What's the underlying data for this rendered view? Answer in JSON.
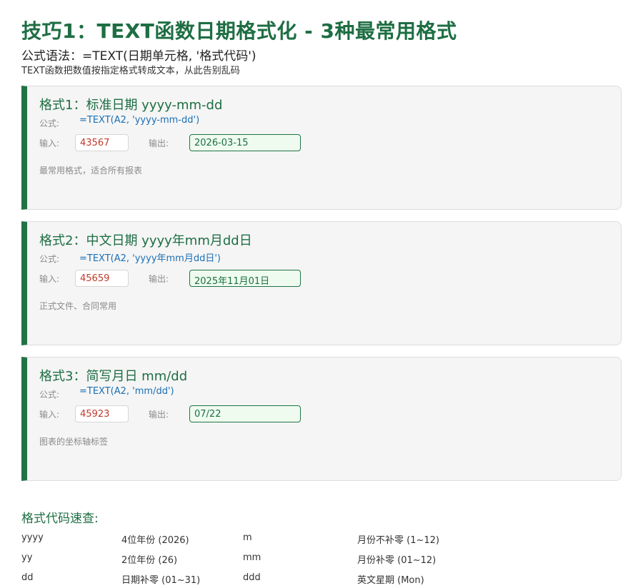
{
  "header": {
    "title": "技巧1：TEXT函数日期格式化 - 3种最常用格式",
    "syntax_label": "公式语法：",
    "syntax_formula": "=TEXT(日期单元格, '格式代码')",
    "subtitle": "TEXT函数把数值按指定格式转成文本，从此告别乱码"
  },
  "labels": {
    "formula": "公式:",
    "input": "输入:",
    "output": "输出:"
  },
  "cards": [
    {
      "title": "格式1：标准日期 yyyy-mm-dd",
      "formula": "=TEXT(A2, 'yyyy-mm-dd')",
      "input": "43567",
      "output": "2026-03-15",
      "note": "最常用格式，适合所有报表"
    },
    {
      "title": "格式2：中文日期 yyyy年mm月dd日",
      "formula": "=TEXT(A2, 'yyyy年mm月dd日')",
      "input": "45659",
      "output": "2025年11月01日",
      "note": "正式文件、合同常用"
    },
    {
      "title": "格式3：简写月日 mm/dd",
      "formula": "=TEXT(A2, 'mm/dd')",
      "input": "45923",
      "output": "07/22",
      "note": "图表的坐标轴标签"
    }
  ],
  "reference": {
    "title": "格式代码速查:",
    "rows": [
      [
        "yyyy",
        "4位年份 (2026)",
        "m",
        "月份不补零 (1~12)"
      ],
      [
        "yy",
        "2位年份 (26)",
        "mm",
        "月份补零 (01~12)"
      ],
      [
        "dd",
        "日期补零 (01~31)",
        "ddd",
        "英文星期 (Mon)"
      ]
    ]
  },
  "colors": {
    "accent": "#217346",
    "title_green": "#1e6e43",
    "formula_blue": "#1a6fb5",
    "input_red": "#c0392b",
    "output_bg": "#eefbee"
  }
}
